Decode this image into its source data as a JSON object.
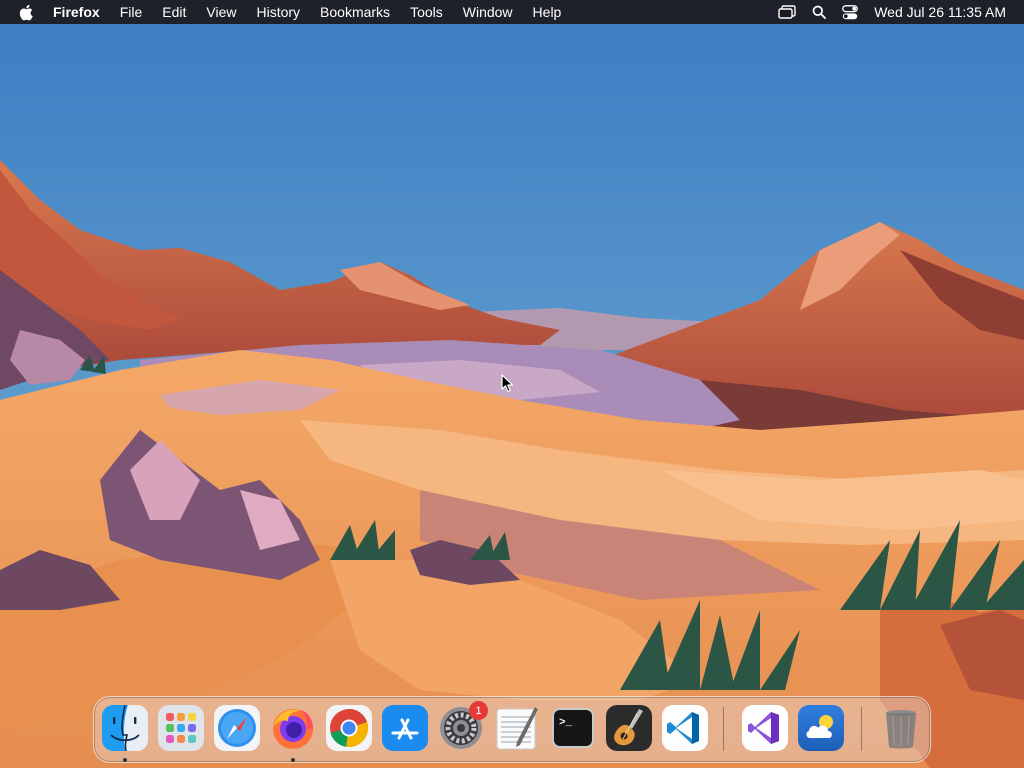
{
  "menubar": {
    "apple_icon": "apple-logo-icon",
    "app_name": "Firefox",
    "menus": [
      "File",
      "Edit",
      "View",
      "History",
      "Bookmarks",
      "Tools",
      "Window",
      "Help"
    ],
    "status_icons": [
      "screen-mirroring-icon",
      "spotlight-search-icon",
      "control-center-icon"
    ],
    "clock": "Wed Jul 26  11:35 AM"
  },
  "dock": {
    "apps": [
      {
        "name": "Finder",
        "icon": "finder-icon",
        "running": true
      },
      {
        "name": "Launchpad",
        "icon": "launchpad-icon",
        "running": false
      },
      {
        "name": "Safari",
        "icon": "safari-icon",
        "running": false
      },
      {
        "name": "Firefox",
        "icon": "firefox-icon",
        "running": true
      },
      {
        "name": "Google Chrome",
        "icon": "chrome-icon",
        "running": false
      },
      {
        "name": "App Store",
        "icon": "app-store-icon",
        "running": false
      },
      {
        "name": "System Settings",
        "icon": "system-settings-icon",
        "running": false,
        "badge": "1"
      },
      {
        "name": "TextEdit",
        "icon": "textedit-icon",
        "running": false
      },
      {
        "name": "Terminal",
        "icon": "terminal-icon",
        "running": false
      },
      {
        "name": "GarageBand",
        "icon": "garageband-icon",
        "running": false
      },
      {
        "name": "Visual Studio Code",
        "icon": "vscode-icon",
        "running": false
      },
      {
        "name": "Visual Studio",
        "icon": "visual-studio-icon",
        "running": false
      },
      {
        "name": "Weather",
        "icon": "weather-icon",
        "running": false
      },
      {
        "name": "Trash",
        "icon": "trash-icon",
        "running": false
      }
    ],
    "terminal_prompt": ">_"
  },
  "colors": {
    "menubar_bg": "#1c1a1e",
    "sky_top": "#3f7fc4",
    "sky_bottom": "#7fb6d8",
    "sand": "#f0a063",
    "badge": "#e53a35"
  }
}
